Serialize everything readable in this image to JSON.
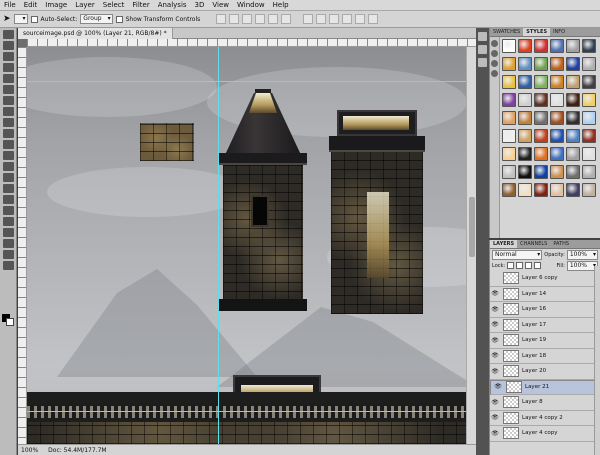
{
  "menu": [
    "File",
    "Edit",
    "Image",
    "Layer",
    "Select",
    "Filter",
    "Analysis",
    "3D",
    "View",
    "Window",
    "Help"
  ],
  "options_bar": {
    "move_tool_icon": "move-arrow-icon",
    "auto_select_label": "Auto-Select:",
    "auto_select_value": "Group",
    "transform_label": "Show Transform Controls"
  },
  "document": {
    "tab_title": "sourceimage.psd @ 100% (Layer 21, RGB/8#) *",
    "zoom": "100%",
    "doc_info": "Doc: 54.4M/177.7M"
  },
  "panels": {
    "top_tabs": [
      "SWATCHES",
      "STYLES",
      "INFO"
    ],
    "active_top_tab": "STYLES",
    "layer_tabs": [
      "LAYERS",
      "CHANNELS",
      "PATHS"
    ],
    "blend_mode": "Normal",
    "opacity_label": "Opacity:",
    "opacity_value": "100%",
    "lock_label": "Lock:",
    "fill_label": "Fill:",
    "fill_value": "100%"
  },
  "layers": [
    {
      "name": "Layer 6 copy",
      "visible": false,
      "selected": false
    },
    {
      "name": "Layer 14",
      "visible": true,
      "selected": false
    },
    {
      "name": "Layer 16",
      "visible": true,
      "selected": false
    },
    {
      "name": "Layer 17",
      "visible": true,
      "selected": false
    },
    {
      "name": "Layer 19",
      "visible": true,
      "selected": false
    },
    {
      "name": "Layer 18",
      "visible": true,
      "selected": false
    },
    {
      "name": "Layer 20",
      "visible": true,
      "selected": false
    },
    {
      "name": "Layer 21",
      "visible": true,
      "selected": true
    },
    {
      "name": "Layer 8",
      "visible": true,
      "selected": false
    },
    {
      "name": "Layer 4 copy 2",
      "visible": true,
      "selected": false
    },
    {
      "name": "Layer 4 copy",
      "visible": true,
      "selected": false
    }
  ],
  "style_colors": [
    "#ffffff",
    "#e04020",
    "#d03030",
    "#5070b0",
    "#a0a0a0",
    "#304050",
    "#e0a030",
    "#6090c0",
    "#70a050",
    "#c06020",
    "#2040a0",
    "#b0b0b0",
    "#e8c040",
    "#3060a0",
    "#80b060",
    "#d08020",
    "#c0a070",
    "#404040",
    "#8040a0",
    "#d0d0d0",
    "#603020",
    "#e0e0e0",
    "#402010",
    "#f0d060",
    "#e0a060",
    "#c08040",
    "#707070",
    "#a05020",
    "#303030",
    "#b0d0f0",
    "#f0f0f0",
    "#d0a060",
    "#c04020",
    "#2050b0",
    "#5080c0",
    "#903020",
    "#f8d090",
    "#202020",
    "#e07020",
    "#4070c0",
    "#a0a0a0",
    "#e0e0e0",
    "#c0c0c0",
    "#101010",
    "#1040a0",
    "#d09050",
    "#707070",
    "#b0b0b0",
    "#906030",
    "#f0e0c0",
    "#802010",
    "#e0c0a0",
    "#404060",
    "#c0b0a0"
  ]
}
